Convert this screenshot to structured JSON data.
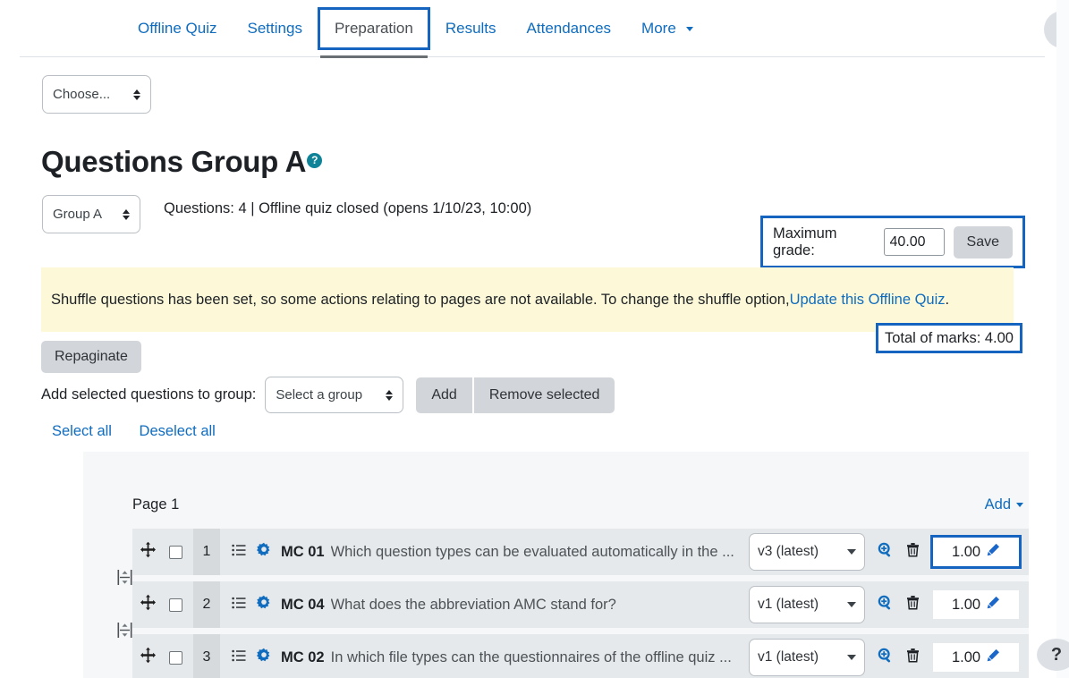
{
  "nav": {
    "tabs": [
      {
        "label": "Offline Quiz",
        "active": false,
        "boxed": false,
        "caret": false
      },
      {
        "label": "Settings",
        "active": false,
        "boxed": false,
        "caret": false
      },
      {
        "label": "Preparation",
        "active": true,
        "boxed": true,
        "caret": false
      },
      {
        "label": "Results",
        "active": false,
        "boxed": false,
        "caret": false
      },
      {
        "label": "Attendances",
        "active": false,
        "boxed": false,
        "caret": false
      },
      {
        "label": "More",
        "active": false,
        "boxed": false,
        "caret": true
      }
    ]
  },
  "choose_select": {
    "value": "Choose..."
  },
  "heading": {
    "title": "Questions Group A",
    "help_icon": "question-mark-icon",
    "help_label": "?"
  },
  "group_select": {
    "value": "Group A"
  },
  "quiz_info": "Questions: 4 | Offline quiz closed (opens 1/10/23, 10:00)",
  "maximum_grade": {
    "label": "Maximum grade:",
    "value": "40.00",
    "save_label": "Save"
  },
  "alert": {
    "text_before": "Shuffle questions has been set, so some actions relating to pages are not available. To change the shuffle option, ",
    "link": "Update this Offline Quiz",
    "text_after": "."
  },
  "total_marks": "Total of marks: 4.00",
  "repaginate_label": "Repaginate",
  "add_selected": {
    "label": "Add selected questions to group:",
    "group_value": "Select a group",
    "add_label": "Add",
    "remove_label": "Remove selected"
  },
  "select_links": {
    "select_all": "Select all",
    "deselect_all": "Deselect all"
  },
  "question_list": {
    "page_label": "Page 1",
    "add_label": "Add",
    "rows": [
      {
        "number": "1",
        "code": "MC 01",
        "text": "Which question types can be evaluated automatically in the ...",
        "version": "v3 (latest)",
        "mark": "1.00",
        "mark_boxed": true
      },
      {
        "number": "2",
        "code": "MC 04",
        "text": "What does the abbreviation AMC stand for?",
        "version": "v1 (latest)",
        "mark": "1.00",
        "mark_boxed": false
      },
      {
        "number": "3",
        "code": "MC 02",
        "text": "In which file types can the questionnaires of the offline quiz ...",
        "version": "v1 (latest)",
        "mark": "1.00",
        "mark_boxed": false
      }
    ]
  },
  "help_fab": {
    "label": "?"
  },
  "colors": {
    "link": "#0f6cbf",
    "annotation_box": "#1565c0",
    "alert_background": "#fcf8d8",
    "help_icon": "#0f8397",
    "row_background": "#e6e9eb"
  }
}
